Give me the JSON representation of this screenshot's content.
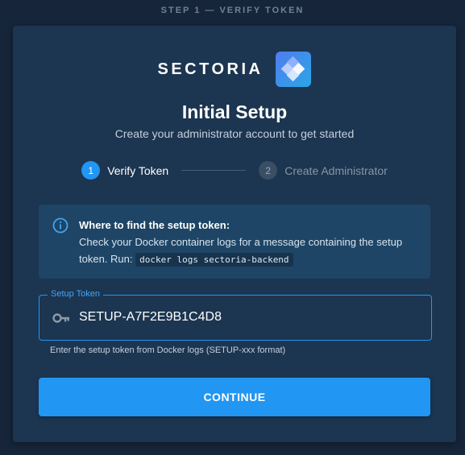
{
  "header": {
    "step_caption": "STEP 1 — VERIFY TOKEN"
  },
  "brand": {
    "name": "SECTORIA",
    "logo_icon": "diamond-cluster-icon"
  },
  "heading": {
    "title": "Initial Setup",
    "subtitle": "Create your administrator account to get started"
  },
  "stepper": {
    "steps": [
      {
        "number": "1",
        "label": "Verify Token",
        "state": "active"
      },
      {
        "number": "2",
        "label": "Create Administrator",
        "state": "inactive"
      }
    ]
  },
  "info": {
    "icon": "info-icon",
    "heading": "Where to find the setup token:",
    "body_prefix": "Check your Docker container logs for a message containing the setup token. Run:",
    "command": "docker logs sectoria-backend"
  },
  "token_field": {
    "label": "Setup Token",
    "value": "SETUP-A7F2E9B1C4D8",
    "icon": "key-icon",
    "helper": "Enter the setup token from Docker logs (SETUP-xxx format)"
  },
  "actions": {
    "continue_label": "CONTINUE"
  },
  "colors": {
    "background": "#16253a",
    "card": "#1c3550",
    "accent": "#2196f3",
    "info_bg": "#1e4565"
  }
}
